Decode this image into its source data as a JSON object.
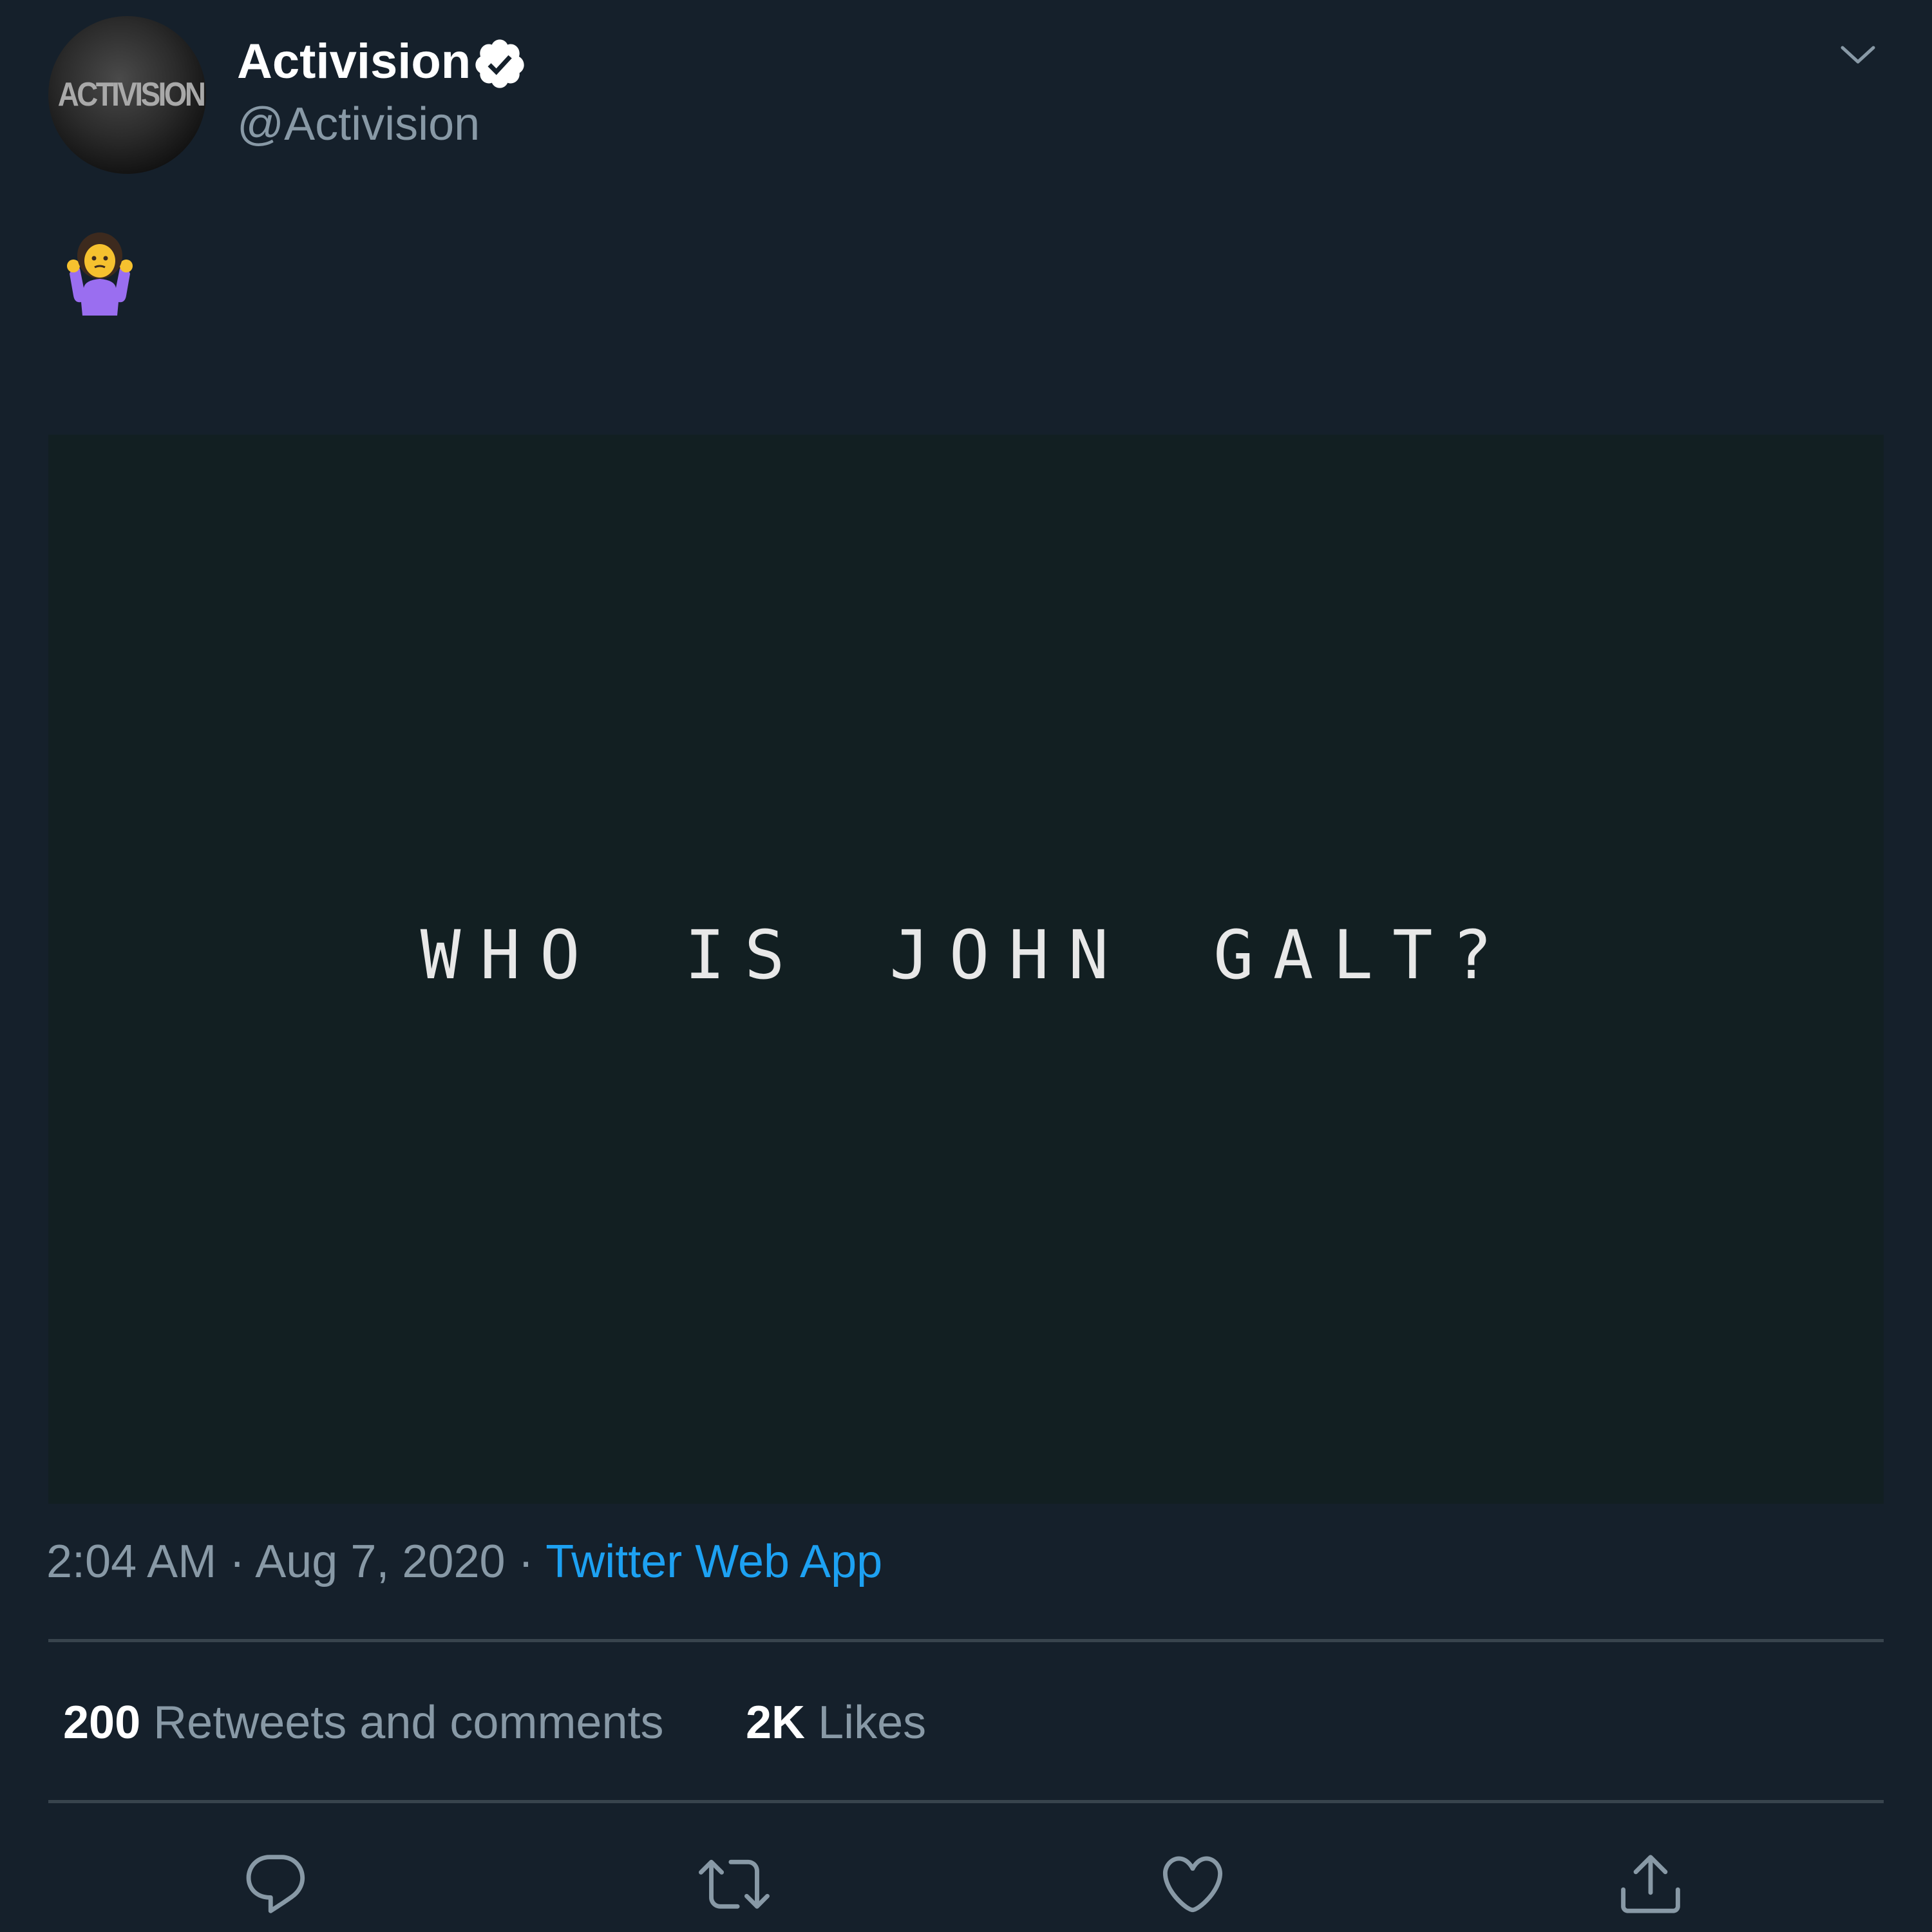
{
  "author": {
    "display_name": "Activision",
    "handle": "@Activision",
    "avatar_logo_text": "ACTIVISION",
    "verified": true
  },
  "tweet": {
    "emoji": "person-shrugging",
    "media_text": "WHO IS JOHN GALT?",
    "time": "2:04 AM",
    "date": "Aug 7, 2020",
    "separator": "·",
    "source": "Twitter Web App"
  },
  "stats": {
    "retweets_count": "200",
    "retweets_label": "Retweets and comments",
    "likes_count": "2K",
    "likes_label": "Likes"
  },
  "actions": [
    "reply-icon",
    "retweet-icon",
    "like-icon",
    "share-icon"
  ],
  "colors": {
    "background": "#15202b",
    "media_background": "#121f22",
    "secondary_text": "#8899a6",
    "link": "#1da1f2",
    "divider": "#38444d"
  }
}
